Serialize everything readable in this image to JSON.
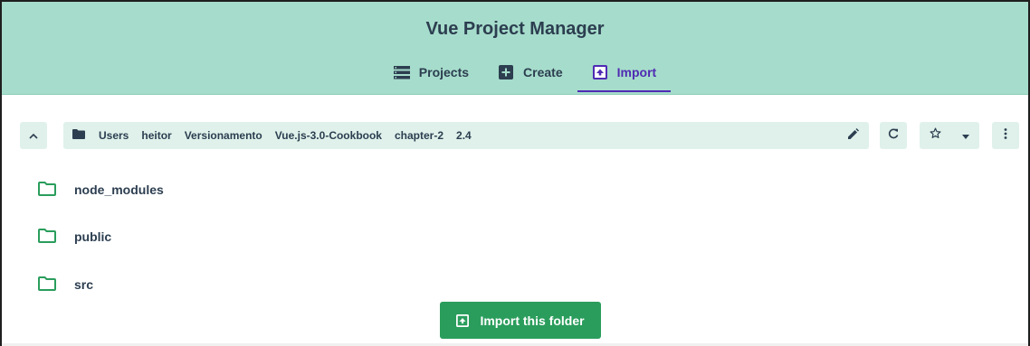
{
  "app": {
    "title": "Vue Project Manager"
  },
  "tabs": [
    {
      "label": "Projects",
      "icon": "list-icon",
      "active": false
    },
    {
      "label": "Create",
      "icon": "plus-box-icon",
      "active": false
    },
    {
      "label": "Import",
      "icon": "import-box-icon",
      "active": true
    }
  ],
  "path": {
    "segments": [
      "Users",
      "heitor",
      "Versionamento",
      "Vue.js-3.0-Cookbook",
      "chapter-2",
      "2.4"
    ]
  },
  "files": [
    {
      "name": "node_modules",
      "icon": "folder-outline-icon"
    },
    {
      "name": "public",
      "icon": "folder-outline-icon"
    },
    {
      "name": "src",
      "icon": "folder-outline-icon"
    }
  ],
  "import_button": {
    "label": "Import this folder",
    "icon": "import-box-icon"
  },
  "colors": {
    "header": "#a6dccb",
    "accent": "#4f2bb3",
    "toolbar": "#dff1ea",
    "button": "#2a9d5c",
    "text": "#2c3e50"
  }
}
